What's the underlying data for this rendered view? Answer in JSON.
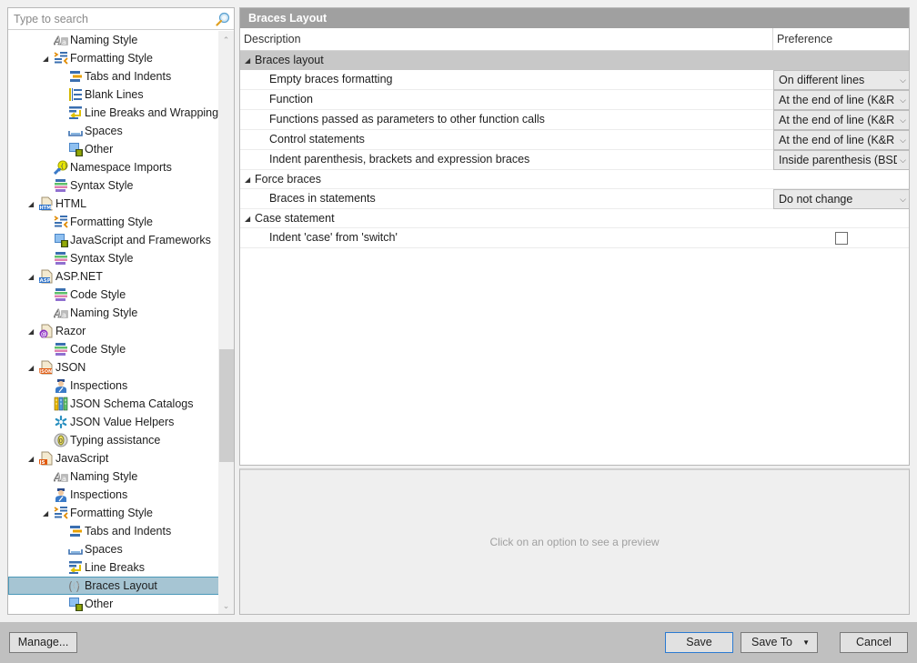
{
  "search": {
    "placeholder": "Type to search",
    "value": ""
  },
  "tree": {
    "items": [
      {
        "label": "Naming Style",
        "level": 2,
        "icon": "naming-style-icon",
        "expanded": null
      },
      {
        "label": "Formatting Style",
        "level": 2,
        "icon": "formatting-style-icon",
        "expanded": true
      },
      {
        "label": "Tabs and Indents",
        "level": 3,
        "icon": "tabs-indents-icon",
        "expanded": null
      },
      {
        "label": "Blank Lines",
        "level": 3,
        "icon": "blank-lines-icon",
        "expanded": null
      },
      {
        "label": "Line Breaks and Wrapping",
        "level": 3,
        "icon": "line-breaks-icon",
        "expanded": null
      },
      {
        "label": "Spaces",
        "level": 3,
        "icon": "spaces-icon",
        "expanded": null
      },
      {
        "label": "Other",
        "level": 3,
        "icon": "other-icon",
        "expanded": null
      },
      {
        "label": "Namespace Imports",
        "level": 2,
        "icon": "namespace-imports-icon",
        "expanded": null
      },
      {
        "label": "Syntax Style",
        "level": 2,
        "icon": "syntax-style-icon",
        "expanded": null
      },
      {
        "label": "HTML",
        "level": 1,
        "icon": "html-file-icon",
        "expanded": true
      },
      {
        "label": "Formatting Style",
        "level": 2,
        "icon": "formatting-style-icon",
        "expanded": null
      },
      {
        "label": "JavaScript and Frameworks",
        "level": 2,
        "icon": "other-icon",
        "expanded": null
      },
      {
        "label": "Syntax Style",
        "level": 2,
        "icon": "syntax-style-icon",
        "expanded": null
      },
      {
        "label": "ASP.NET",
        "level": 1,
        "icon": "aspnet-file-icon",
        "expanded": true
      },
      {
        "label": "Code Style",
        "level": 2,
        "icon": "syntax-style-icon",
        "expanded": null
      },
      {
        "label": "Naming Style",
        "level": 2,
        "icon": "naming-style-icon",
        "expanded": null
      },
      {
        "label": "Razor",
        "level": 1,
        "icon": "razor-file-icon",
        "expanded": true
      },
      {
        "label": "Code Style",
        "level": 2,
        "icon": "syntax-style-icon",
        "expanded": null
      },
      {
        "label": "JSON",
        "level": 1,
        "icon": "json-file-icon",
        "expanded": true
      },
      {
        "label": "Inspections",
        "level": 2,
        "icon": "inspections-icon",
        "expanded": null
      },
      {
        "label": "JSON Schema Catalogs",
        "level": 2,
        "icon": "schema-catalogs-icon",
        "expanded": null
      },
      {
        "label": "JSON Value Helpers",
        "level": 2,
        "icon": "value-helpers-icon",
        "expanded": null
      },
      {
        "label": "Typing assistance",
        "level": 2,
        "icon": "typing-assistance-icon",
        "expanded": null
      },
      {
        "label": "JavaScript",
        "level": 1,
        "icon": "javascript-file-icon",
        "expanded": true
      },
      {
        "label": "Naming Style",
        "level": 2,
        "icon": "naming-style-icon",
        "expanded": null
      },
      {
        "label": "Inspections",
        "level": 2,
        "icon": "inspections-icon",
        "expanded": null
      },
      {
        "label": "Formatting Style",
        "level": 2,
        "icon": "formatting-style-icon",
        "expanded": true
      },
      {
        "label": "Tabs and Indents",
        "level": 3,
        "icon": "tabs-indents-icon",
        "expanded": null
      },
      {
        "label": "Spaces",
        "level": 3,
        "icon": "spaces-icon",
        "expanded": null
      },
      {
        "label": "Line Breaks",
        "level": 3,
        "icon": "line-breaks-icon",
        "expanded": null
      },
      {
        "label": "Braces Layout",
        "level": 3,
        "icon": "braces-layout-icon",
        "expanded": null,
        "selected": true
      },
      {
        "label": "Other",
        "level": 3,
        "icon": "other-icon",
        "expanded": null
      }
    ]
  },
  "panel": {
    "title": "Braces Layout",
    "columns": {
      "description": "Description",
      "preference": "Preference"
    },
    "groups": [
      {
        "label": "Braces layout",
        "style": "shaded",
        "options": [
          {
            "label": "Empty braces formatting",
            "type": "dropdown",
            "value": "On different lines"
          },
          {
            "label": "Function",
            "type": "dropdown",
            "value": "At the end of line (K&R style)"
          },
          {
            "label": "Functions passed as parameters to other function calls",
            "type": "dropdown",
            "value": "At the end of line (K&R style)"
          },
          {
            "label": "Control statements",
            "type": "dropdown",
            "value": "At the end of line (K&R style)"
          },
          {
            "label": "Indent parenthesis, brackets and expression braces",
            "type": "dropdown",
            "value": "Inside parenthesis (BSD/K&R style)"
          }
        ]
      },
      {
        "label": "Force braces",
        "style": "plain",
        "options": [
          {
            "label": "Braces in statements",
            "type": "dropdown",
            "value": "Do not change"
          }
        ]
      },
      {
        "label": "Case statement",
        "style": "plain",
        "options": [
          {
            "label": "Indent 'case' from 'switch'",
            "type": "checkbox",
            "checked": false
          }
        ]
      }
    ]
  },
  "preview": {
    "placeholder": "Click on an option to see a preview"
  },
  "buttons": {
    "manage": "Manage...",
    "save": "Save",
    "save_to": "Save To",
    "cancel": "Cancel"
  },
  "colors": {
    "selection": "#a6c5d3",
    "selection_border": "#4a98b8",
    "header": "#a0a0a0",
    "group_shade": "#c8c8c8",
    "default_button_border": "#2b7ad1"
  }
}
